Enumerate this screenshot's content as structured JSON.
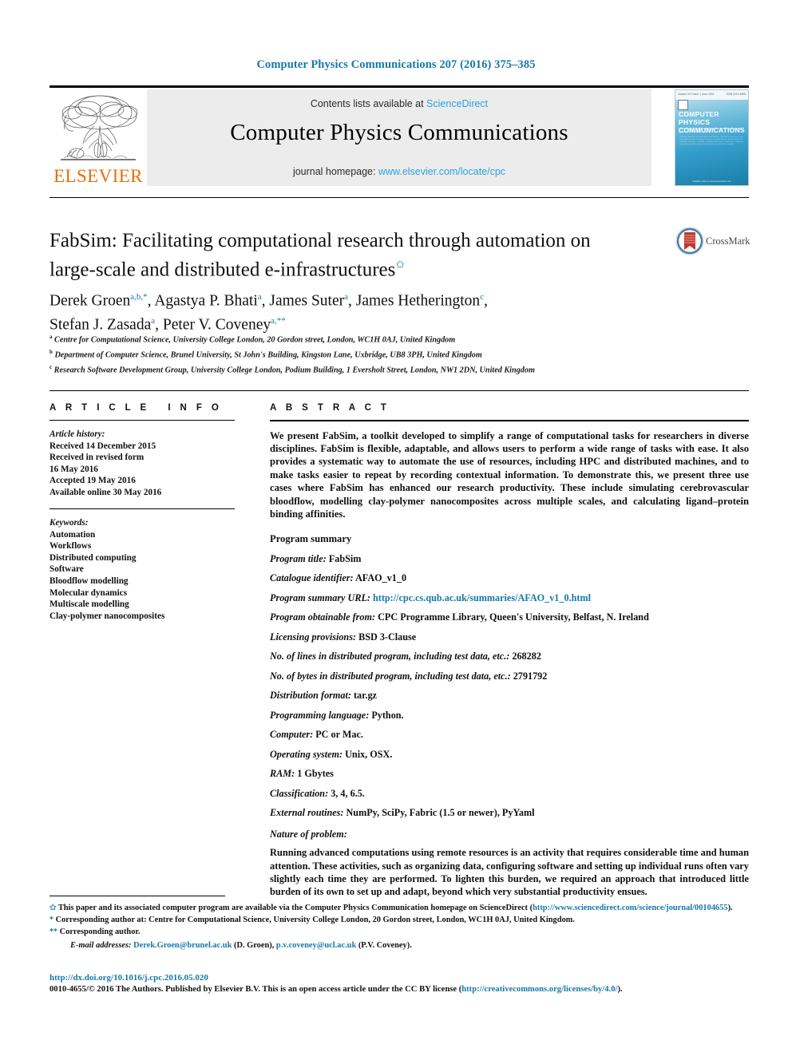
{
  "running_head": "Computer Physics Communications 207 (2016) 375–385",
  "masthead": {
    "contents_prefix": "Contents lists available at ",
    "sciencedirect": "ScienceDirect",
    "journal_name": "Computer Physics Communications",
    "homepage_prefix": "journal homepage: ",
    "homepage_url": "www.elsevier.com/locate/cpc",
    "publisher": "ELSEVIER",
    "cover": {
      "volume_line": "Volume 207 Issue 1 June 2016",
      "issn_line": "ISSN 0010-4655",
      "title_line1": "COMPUTER PHYSICS",
      "title_line2": "COMMUNICATIONS",
      "subtitle": "An international journal and program library for computational physics and physical chemistry",
      "footer": "Available online at www.sciencedirect.com"
    }
  },
  "article": {
    "title": "FabSim: Facilitating computational research through automation on large-scale and distributed e-infrastructures",
    "title_marker": "✩",
    "authors_line1": "Derek Groen",
    "authors": [
      {
        "name": "Derek Groen",
        "sup": "a,b,*"
      },
      {
        "name": "Agastya P. Bhati",
        "sup": "a"
      },
      {
        "name": "James Suter",
        "sup": "a"
      },
      {
        "name": "James Hetherington",
        "sup": "c"
      },
      {
        "name": "Stefan J. Zasada",
        "sup": "a"
      },
      {
        "name": "Peter V. Coveney",
        "sup": "a,**"
      }
    ],
    "affiliations": [
      {
        "mark": "a",
        "text": "Centre for Computational Science, University College London, 20 Gordon street, London, WC1H 0AJ, United Kingdom"
      },
      {
        "mark": "b",
        "text": "Department of Computer Science, Brunel University, St John's Building, Kingston Lane, Uxbridge, UB8 3PH, United Kingdom"
      },
      {
        "mark": "c",
        "text": "Research Software Development Group, University College London, Podium Building, 1 Eversholt Street, London, NW1 2DN, United Kingdom"
      }
    ],
    "crossmark_label": "CrossMark"
  },
  "info": {
    "heading": "ARTICLE INFO",
    "history_label": "Article history:",
    "history": [
      "Received 14 December 2015",
      "Received in revised form",
      "16 May 2016",
      "Accepted 19 May 2016",
      "Available online 30 May 2016"
    ],
    "keywords_label": "Keywords:",
    "keywords": [
      "Automation",
      "Workflows",
      "Distributed computing",
      "Software",
      "Bloodflow modelling",
      "Molecular dynamics",
      "Multiscale modelling",
      "Clay-polymer nanocomposites"
    ]
  },
  "abstract": {
    "heading": "ABSTRACT",
    "text": "We present FabSim, a toolkit developed to simplify a range of computational tasks for researchers in diverse disciplines. FabSim is flexible, adaptable, and allows users to perform a wide range of tasks with ease. It also provides a systematic way to automate the use of resources, including HPC and distributed machines, and to make tasks easier to repeat by recording contextual information. To demonstrate this, we present three use cases where FabSim has enhanced our research productivity. These include simulating cerebrovascular bloodflow, modelling clay-polymer nanocomposites across multiple scales, and calculating ligand–protein binding affinities."
  },
  "program_summary": {
    "heading": "Program summary",
    "entries": [
      {
        "label": "Program title:",
        "value": "FabSim"
      },
      {
        "label": "Catalogue identifier:",
        "value": "AFAO_v1_0"
      },
      {
        "label": "Program summary URL:",
        "value": "http://cpc.cs.qub.ac.uk/summaries/AFAO_v1_0.html",
        "is_link": true
      },
      {
        "label": "Program obtainable from:",
        "value": "CPC Programme Library, Queen's University, Belfast, N. Ireland"
      },
      {
        "label": "Licensing provisions:",
        "value": "BSD 3-Clause"
      },
      {
        "label": "No. of lines in distributed program, including test data, etc.:",
        "value": "268282"
      },
      {
        "label": "No. of bytes in distributed program, including test data, etc.:",
        "value": "2791792"
      },
      {
        "label": "Distribution format:",
        "value": "tar.gz"
      },
      {
        "label": "Programming language:",
        "value": "Python."
      },
      {
        "label": "Computer:",
        "value": "PC or Mac."
      },
      {
        "label": "Operating system:",
        "value": "Unix, OSX."
      },
      {
        "label": "RAM:",
        "value": "1 Gbytes"
      },
      {
        "label": "Classification:",
        "value": "3, 4, 6.5."
      },
      {
        "label": "External routines:",
        "value": "NumPy, SciPy, Fabric (1.5 or newer), PyYaml"
      }
    ],
    "nature_label": "Nature of problem:",
    "nature_text": "Running advanced computations using remote resources is an activity that requires considerable time and human attention. These activities, such as organizing data, configuring software and setting up individual runs often vary slightly each time they are performed. To lighten this burden, we required an approach that introduced little burden of its own to set up and adapt, beyond which very substantial productivity ensues."
  },
  "footnotes": {
    "star_note_prefix": "This paper and its associated computer program are available via the Computer Physics Communication homepage on ScienceDirect  (",
    "star_note_link": "http://www.sciencedirect.com/science/journal/00104655",
    "star_note_suffix": ").",
    "corr1_mark": "*",
    "corr1": "Corresponding author at: Centre for Computational Science, University College London, 20 Gordon street, London, WC1H 0AJ, United Kingdom.",
    "corr2_mark": "**",
    "corr2": "Corresponding author.",
    "emails_label": "E-mail addresses:",
    "email1": "Derek.Groen@brunel.ac.uk",
    "email1_name": "(D. Groen),",
    "email2": "p.v.coveney@ucl.ac.uk",
    "email2_name": "(P.V. Coveney).",
    "doi": "http://dx.doi.org/10.1016/j.cpc.2016.05.020",
    "copyright_prefix": "0010-4655/© 2016 The Authors. Published by Elsevier B.V. This is an open access article under the CC BY license (",
    "copyright_link": "http://creativecommons.org/licenses/by/4.0/",
    "copyright_suffix": ")."
  },
  "colors": {
    "link": "#1679a8",
    "sciencedirect": "#2ba3dd",
    "elsevier_orange": "#eb6c09",
    "banner_bg": "#ececec"
  }
}
